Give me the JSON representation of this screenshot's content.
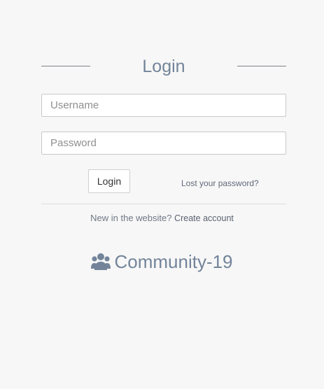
{
  "header": {
    "title": "Login"
  },
  "form": {
    "username_placeholder": "Username",
    "username_value": "",
    "password_placeholder": "Password",
    "password_value": "",
    "login_label": "Login",
    "lost_password_label": "Lost your password?"
  },
  "signup": {
    "prompt": "New in the website?",
    "link_label": "Create account"
  },
  "brand": {
    "icon": "users-icon",
    "name": "Community-19"
  },
  "colors": {
    "background": "#f7f7f7",
    "accent": "#73849a",
    "border": "#c9c9c9"
  }
}
